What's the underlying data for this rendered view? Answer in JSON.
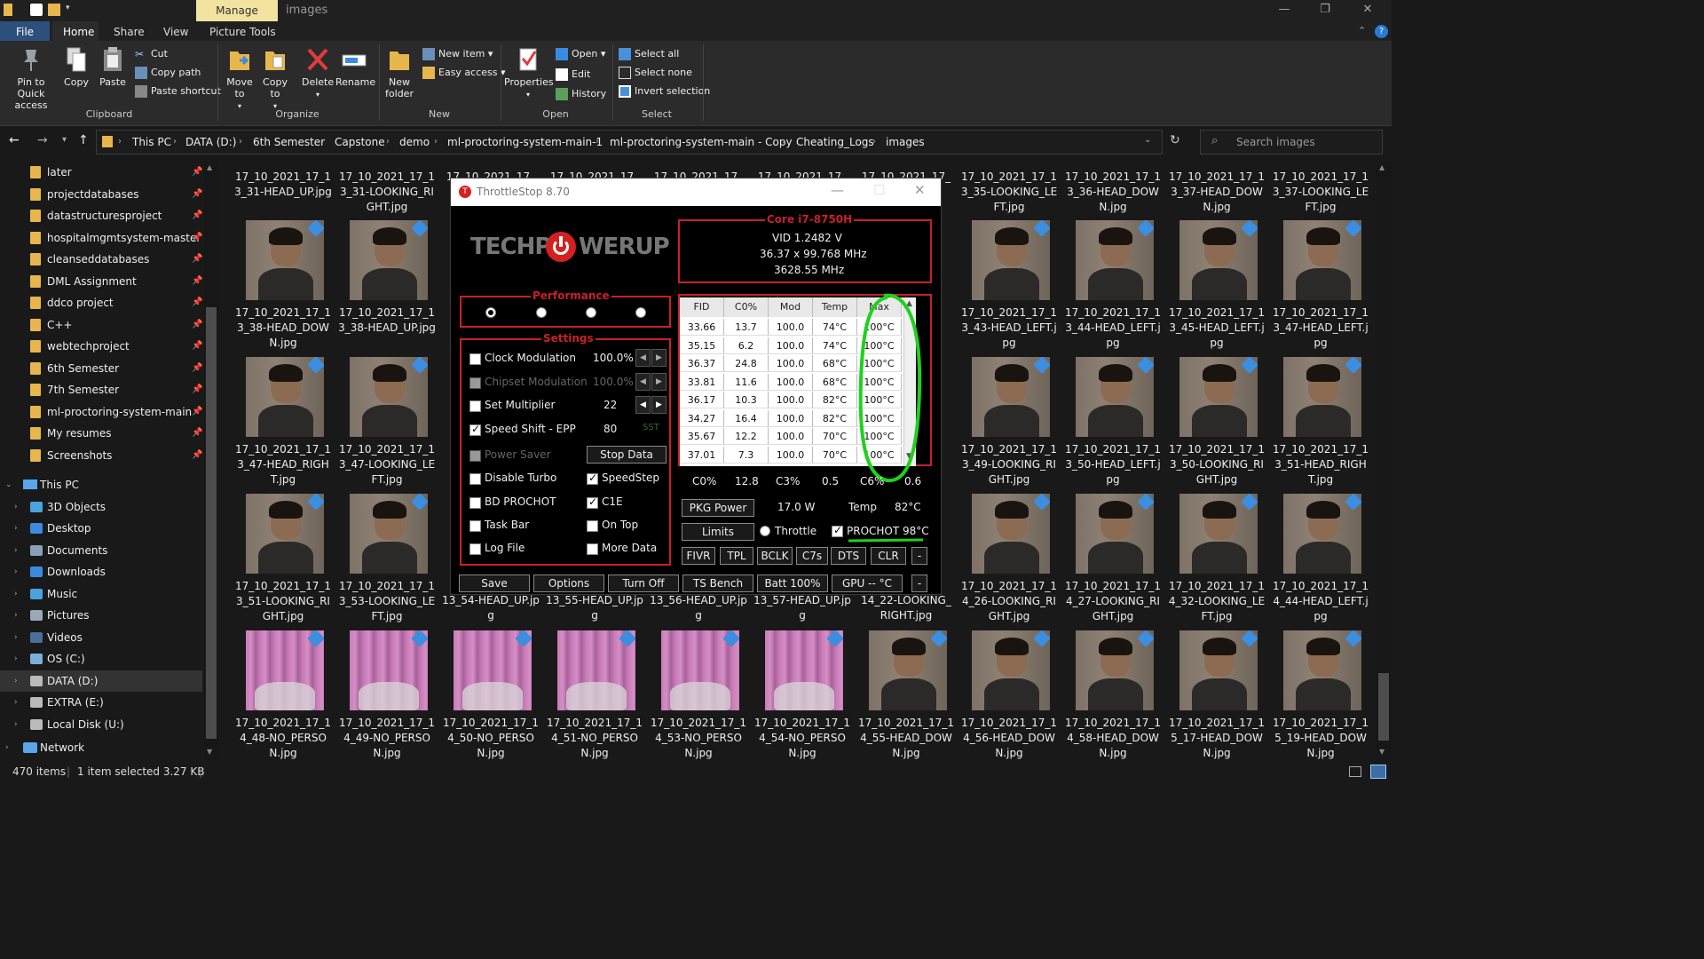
{
  "window": {
    "manage_tab": "Manage",
    "title": "images"
  },
  "ribbon": {
    "tabs": [
      "File",
      "Home",
      "Share",
      "View",
      "Picture Tools"
    ],
    "clipboard": {
      "pin": "Pin to Quick access",
      "copy": "Copy",
      "paste": "Paste",
      "cut": "Cut",
      "copy_path": "Copy path",
      "paste_shortcut": "Paste shortcut",
      "label": "Clipboard"
    },
    "organize": {
      "move_to": "Move to",
      "copy_to": "Copy to",
      "delete": "Delete",
      "rename": "Rename",
      "label": "Organize"
    },
    "new": {
      "new_folder": "New folder",
      "new_item": "New item",
      "easy_access": "Easy access",
      "label": "New"
    },
    "open": {
      "properties": "Properties",
      "open": "Open",
      "edit": "Edit",
      "history": "History",
      "label": "Open"
    },
    "select": {
      "select_all": "Select all",
      "select_none": "Select none",
      "invert": "Invert selection",
      "label": "Select"
    }
  },
  "address": {
    "crumbs": [
      "This PC",
      "DATA (D:)",
      "6th Semester",
      "Capstone",
      "demo",
      "ml-proctoring-system-main-1",
      "ml-proctoring-system-main - Copy",
      "Cheating_Logs",
      "images"
    ],
    "search_placeholder": "Search images"
  },
  "nav": {
    "quick": [
      "later",
      "projectdatabases",
      "datastructuresproject",
      "hospitalmgmtsystem-master",
      "cleanseddatabases",
      "DML Assignment",
      "ddco project",
      "C++",
      "webtechproject",
      "6th Semester",
      "7th Semester",
      "ml-proctoring-system-main - Co",
      "My resumes",
      "Screenshots"
    ],
    "this_pc": "This PC",
    "pc_items": [
      "3D Objects",
      "Desktop",
      "Documents",
      "Downloads",
      "Music",
      "Pictures",
      "Videos",
      "OS (C:)",
      "DATA (D:)",
      "EXTRA (E:)",
      "Local Disk (U:)"
    ],
    "network": "Network"
  },
  "files": {
    "row0": [
      "17_10_2021_17_13_31-HEAD_UP.jpg",
      "17_10_2021_17_13_31-LOOKING_RIGHT.jpg",
      "17_10_2021_17_13_35-LOOKING_LEFT.jpg",
      "17_10_2021_17_13_36-HEAD_DOWN.jpg",
      "17_10_2021_17_13_37-HEAD_DOWN.jpg",
      "17_10_2021_17_13_37-LOOKING_LEFT.jpg"
    ],
    "row0_partial": [
      "17_10_2021_17_",
      "17_10_2021_17_",
      "17_10_2021_17_",
      "17_10_2021_17_",
      "17_10_2021_17_"
    ],
    "row1": [
      "17_10_2021_17_13_38-HEAD_DOWN.jpg",
      "17_10_2021_17_13_38-HEAD_UP.jpg",
      "17_10_2021_17_13_43-HEAD_LEFT.jpg",
      "17_10_2021_17_13_44-HEAD_LEFT.jpg",
      "17_10_2021_17_13_45-HEAD_LEFT.jpg",
      "17_10_2021_17_13_47-HEAD_LEFT.jpg"
    ],
    "row2": [
      "17_10_2021_17_13_47-HEAD_RIGHT.jpg",
      "17_10_2021_17_13_47-LOOKING_LEFT.jpg",
      "17_10_2021_17_13_49-LOOKING_RIGHT.jpg",
      "17_10_2021_17_13_50-HEAD_LEFT.jpg",
      "17_10_2021_17_13_50-LOOKING_RIGHT.jpg",
      "17_10_2021_17_13_51-HEAD_RIGHT.jpg"
    ],
    "row3": [
      "17_10_2021_17_13_51-LOOKING_RIGHT.jpg",
      "17_10_2021_17_13_53-LOOKING_LEFT.jpg",
      "13_54-HEAD_UP.jpg",
      "13_55-HEAD_UP.jpg",
      "13_56-HEAD_UP.jpg",
      "13_57-HEAD_UP.jpg",
      "14_22-LOOKING_RIGHT.jpg",
      "17_10_2021_17_14_26-LOOKING_RIGHT.jpg",
      "17_10_2021_17_14_27-LOOKING_RIGHT.jpg",
      "17_10_2021_17_14_32-LOOKING_LEFT.jpg",
      "17_10_2021_17_14_44-HEAD_LEFT.jpg"
    ],
    "row4": [
      "17_10_2021_17_14_48-NO_PERSON.jpg",
      "17_10_2021_17_14_49-NO_PERSON.jpg",
      "17_10_2021_17_14_50-NO_PERSON.jpg",
      "17_10_2021_17_14_51-NO_PERSON.jpg",
      "17_10_2021_17_14_53-NO_PERSON.jpg",
      "17_10_2021_17_14_54-NO_PERSON.jpg",
      "17_10_2021_17_14_55-HEAD_DOWN.jpg",
      "17_10_2021_17_14_56-HEAD_DOWN.jpg",
      "17_10_2021_17_14_58-HEAD_DOWN.jpg",
      "17_10_2021_17_15_17-HEAD_DOWN.jpg",
      "17_10_2021_17_15_19-HEAD_DOWN.jpg"
    ]
  },
  "status": {
    "count": "470 items",
    "selected": "1 item selected  3.27 KB"
  },
  "throttlestop": {
    "title": "ThrottleStop 8.70",
    "logo": "TECHPOWERUP",
    "cpu": {
      "name": "Core i7-8750H",
      "vid": "VID  1.2482 V",
      "mult": "36.37 x 99.768 MHz",
      "freq": "3628.55 MHz"
    },
    "performance_label": "Performance",
    "settings_label": "Settings",
    "settings": [
      {
        "label": "Clock Modulation",
        "value": "100.0%",
        "checked": false,
        "dim": false
      },
      {
        "label": "Chipset Modulation",
        "value": "100.0%",
        "checked": false,
        "dim": true
      },
      {
        "label": "Set Multiplier",
        "value": "22",
        "checked": false,
        "dim": false
      },
      {
        "label": "Speed Shift - EPP",
        "value": "80",
        "extra": "SST",
        "checked": true,
        "dim": false
      }
    ],
    "power_saver": "Power Saver",
    "stop_data": "Stop Data",
    "left_checks": [
      "Disable Turbo",
      "BD PROCHOT",
      "Task Bar",
      "Log File"
    ],
    "right_checks": [
      {
        "label": "SpeedStep",
        "checked": true
      },
      {
        "label": "C1E",
        "checked": true
      },
      {
        "label": "On Top",
        "checked": false
      },
      {
        "label": "More Data",
        "checked": false
      }
    ],
    "table": {
      "headers": [
        "FID",
        "C0%",
        "Mod",
        "Temp",
        "Max"
      ],
      "rows": [
        [
          "33.66",
          "13.7",
          "100.0",
          "74°C",
          "100°C"
        ],
        [
          "35.15",
          "6.2",
          "100.0",
          "74°C",
          "100°C"
        ],
        [
          "36.37",
          "24.8",
          "100.0",
          "68°C",
          "100°C"
        ],
        [
          "33.81",
          "11.6",
          "100.0",
          "68°C",
          "100°C"
        ],
        [
          "36.17",
          "10.3",
          "100.0",
          "82°C",
          "100°C"
        ],
        [
          "34.27",
          "16.4",
          "100.0",
          "82°C",
          "100°C"
        ],
        [
          "35.67",
          "12.2",
          "100.0",
          "70°C",
          "100°C"
        ],
        [
          "37.01",
          "7.3",
          "100.0",
          "70°C",
          "100°C"
        ]
      ]
    },
    "c_states": {
      "c0_label": "C0%",
      "c0": "12.8",
      "c3_label": "C3%",
      "c3": "0.5",
      "c6_label": "C6%",
      "c6": "0.6"
    },
    "pkg_power": "PKG Power",
    "pkg_value": "17.0 W",
    "temp_label": "Temp",
    "temp_value": "82°C",
    "limits": "Limits",
    "throttle": "Throttle",
    "prochot": "PROCHOT 98°C",
    "small_buttons": [
      "FIVR",
      "TPL",
      "BCLK",
      "C7s",
      "DTS",
      "CLR",
      "-"
    ],
    "bottom_buttons": [
      "Save",
      "Options",
      "Turn Off",
      "TS Bench",
      "Batt 100%",
      "GPU -- °C",
      "-"
    ]
  }
}
